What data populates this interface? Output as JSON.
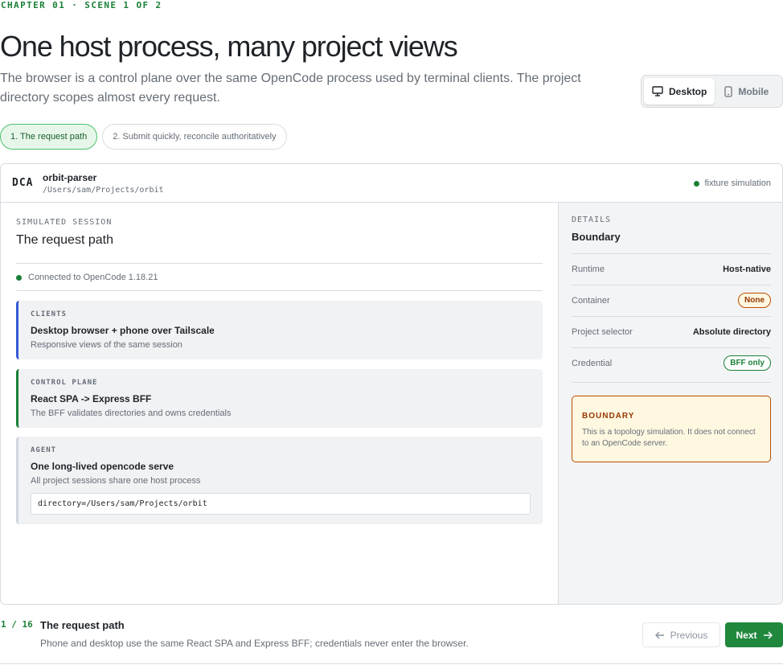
{
  "chapter_label": "CHAPTER 01 · SCENE 1 OF 2",
  "title": "One host process, many project views",
  "subtitle": "The browser is a control plane over the same OpenCode process used by terminal clients. The project directory scopes almost every request.",
  "viewport_toggle": {
    "desktop": "Desktop",
    "mobile": "Mobile",
    "selected": "Desktop"
  },
  "scene_tabs": [
    {
      "label": "1. The request path",
      "active": true
    },
    {
      "label": "2. Submit quickly, reconcile authoritatively",
      "active": false
    }
  ],
  "header": {
    "badge": "DCA",
    "project_name": "orbit-parser",
    "project_path": "/Users/sam/Projects/orbit",
    "status": "fixture simulation"
  },
  "main": {
    "section_label": "SIMULATED SESSION",
    "section_title": "The request path",
    "connection": "Connected to OpenCode 1.18.21",
    "cards": [
      {
        "label": "CLIENTS",
        "title": "Desktop browser + phone over Tailscale",
        "desc": "Responsive views of the same session"
      },
      {
        "label": "CONTROL PLANE",
        "title": "React SPA -> Express BFF",
        "desc": "The BFF validates directories and owns credentials"
      },
      {
        "label": "AGENT",
        "title": "One long-lived opencode serve",
        "desc": "All project sessions share one host process",
        "code": "directory=/Users/sam/Projects/orbit"
      }
    ]
  },
  "details": {
    "label": "DETAILS",
    "title": "Boundary",
    "rows": [
      {
        "key": "Runtime",
        "value": "Host-native"
      },
      {
        "key": "Container",
        "value": "None"
      },
      {
        "key": "Project selector",
        "value": "Absolute directory"
      },
      {
        "key": "Credential",
        "value": "BFF only"
      }
    ],
    "callout": {
      "label": "BOUNDARY",
      "text": "This is a topology simulation. It does not connect to an OpenCode server."
    }
  },
  "footer": {
    "step": "1 / 16",
    "title": "The request path",
    "desc": "Phone and desktop use the same React SPA and Express BFF; credentials never enter the browser.",
    "previous": "Previous",
    "next": "Next"
  },
  "colors": {
    "accent": "#1a7f37",
    "clients_border": "#3358d4",
    "warning": "#bc4c00"
  }
}
